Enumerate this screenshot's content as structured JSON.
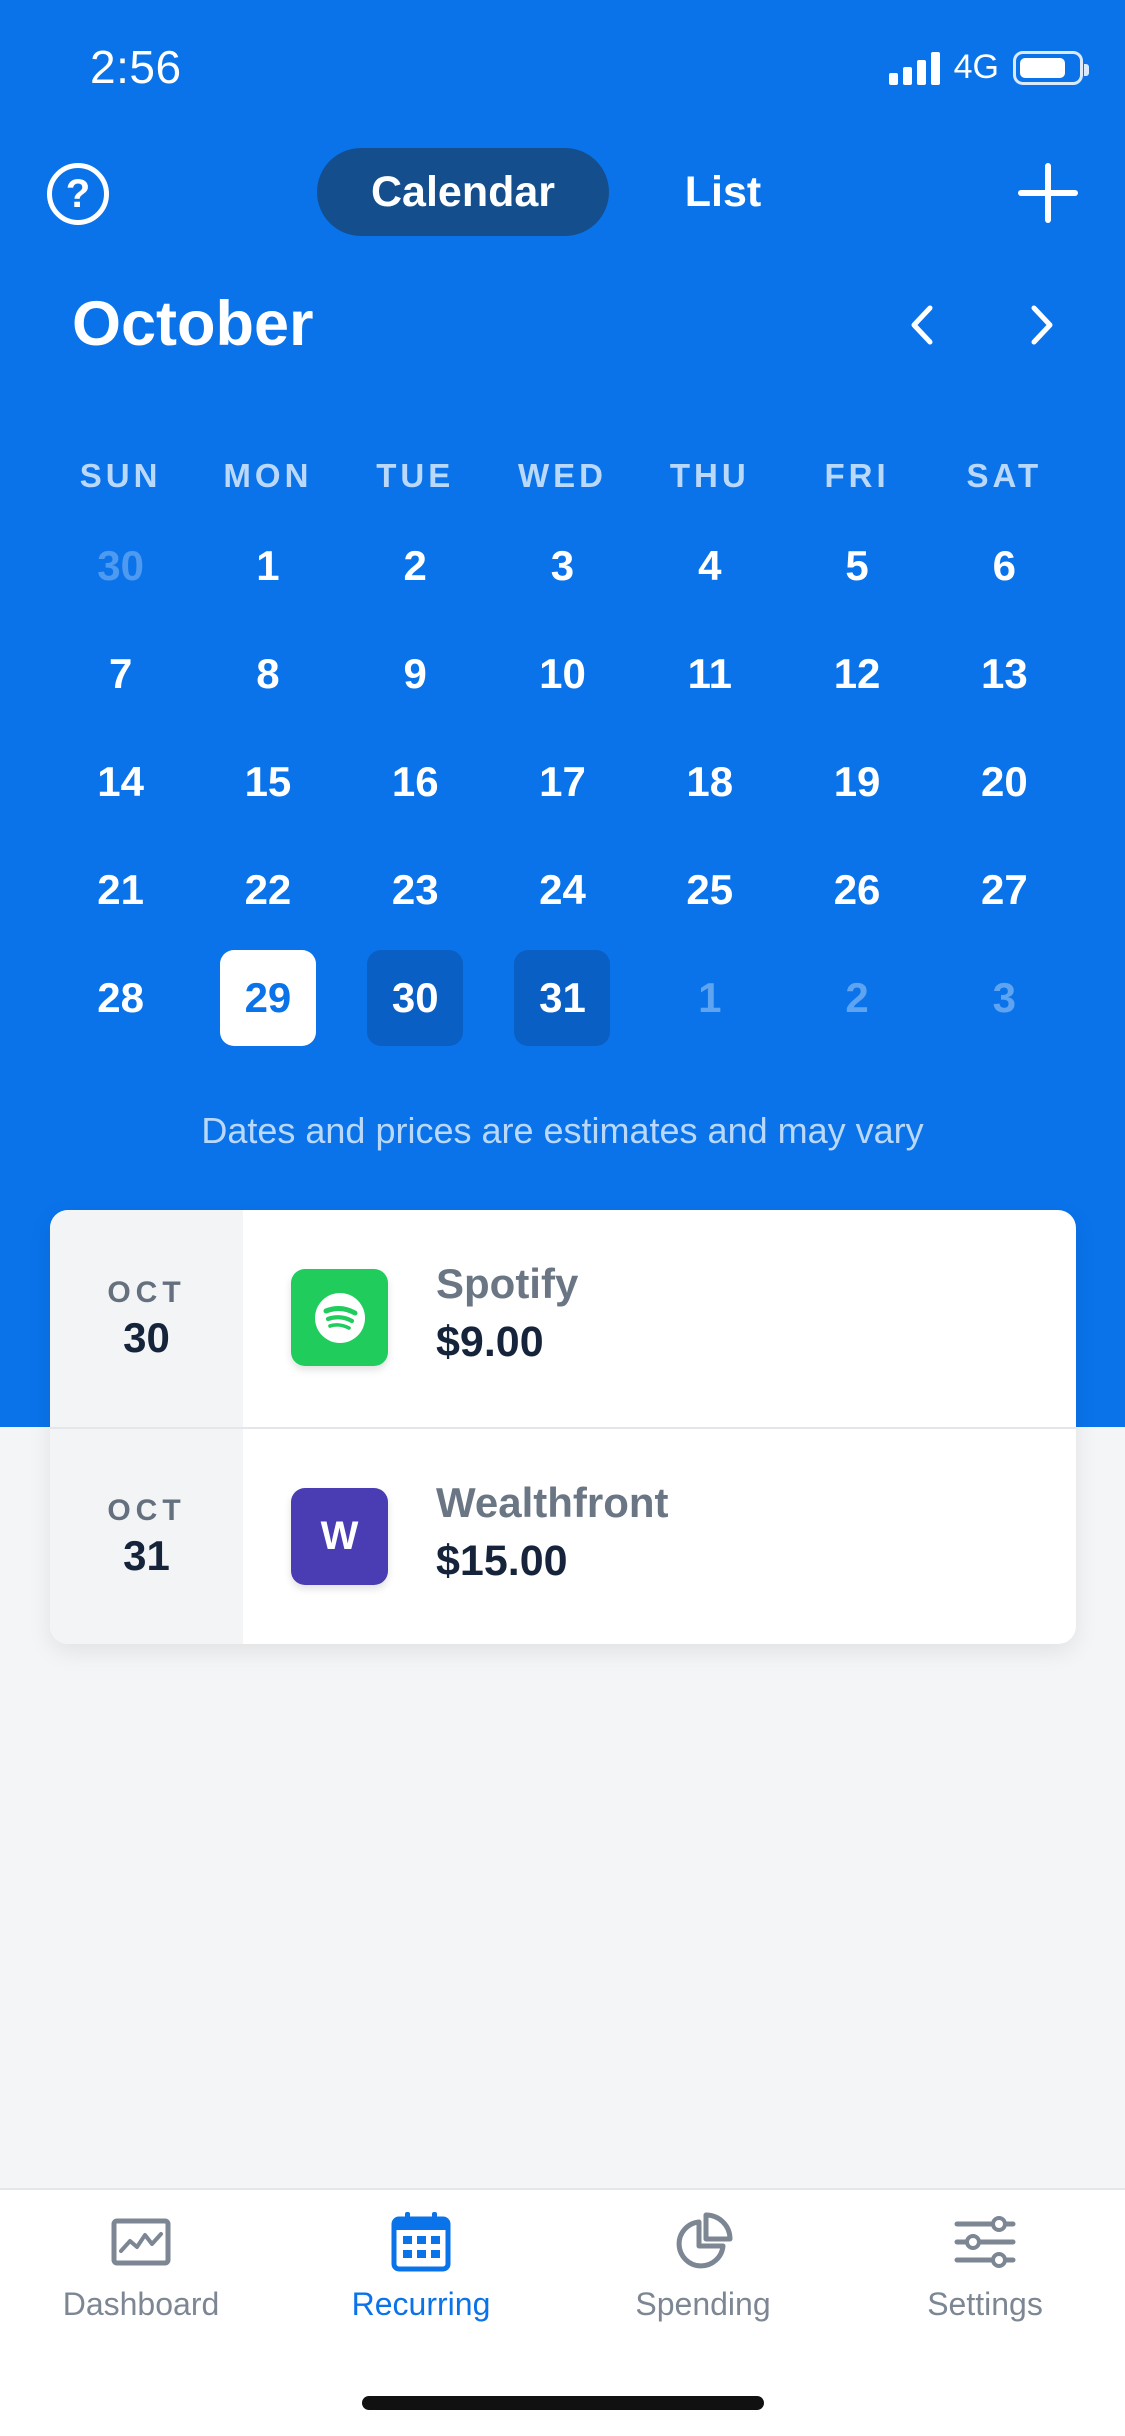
{
  "status_bar": {
    "time": "2:56",
    "network": "4G"
  },
  "header": {
    "help_icon": "question-circle-icon",
    "segments": [
      {
        "label": "Calendar",
        "active": true
      },
      {
        "label": "List",
        "active": false
      }
    ],
    "add_icon": "plus-icon"
  },
  "calendar": {
    "month": "October",
    "weekdays": [
      "SUN",
      "MON",
      "TUE",
      "WED",
      "THU",
      "FRI",
      "SAT"
    ],
    "weeks": [
      [
        "30",
        "1",
        "2",
        "3",
        "4",
        "5",
        "6"
      ],
      [
        "7",
        "8",
        "9",
        "10",
        "11",
        "12",
        "13"
      ],
      [
        "14",
        "15",
        "16",
        "17",
        "18",
        "19",
        "20"
      ],
      [
        "21",
        "22",
        "23",
        "24",
        "25",
        "26",
        "27"
      ],
      [
        "28",
        "29",
        "30",
        "31",
        "1",
        "2",
        "3"
      ]
    ],
    "today": "29",
    "bill_days": [
      "30",
      "31"
    ],
    "disclaimer": "Dates and prices are estimates and may vary"
  },
  "bills": [
    {
      "month": "OCT",
      "day": "30",
      "name": "Spotify",
      "amount": "$9.00",
      "logo": "spotify-logo",
      "color": "#1fcc5c"
    },
    {
      "month": "OCT",
      "day": "31",
      "name": "Wealthfront",
      "amount": "$15.00",
      "logo_letter": "W",
      "color": "#4a3db3"
    }
  ],
  "tabs": [
    {
      "label": "Dashboard",
      "icon": "chart-icon",
      "active": false
    },
    {
      "label": "Recurring",
      "icon": "calendar-icon",
      "active": true
    },
    {
      "label": "Spending",
      "icon": "pie-chart-icon",
      "active": false
    },
    {
      "label": "Settings",
      "icon": "sliders-icon",
      "active": false
    }
  ],
  "colors": {
    "primary": "#0a73ea",
    "segment_active": "#144e8c",
    "bill_day": "#0a5fc4",
    "text_dark": "#16243b",
    "text_muted": "#6b7685"
  }
}
